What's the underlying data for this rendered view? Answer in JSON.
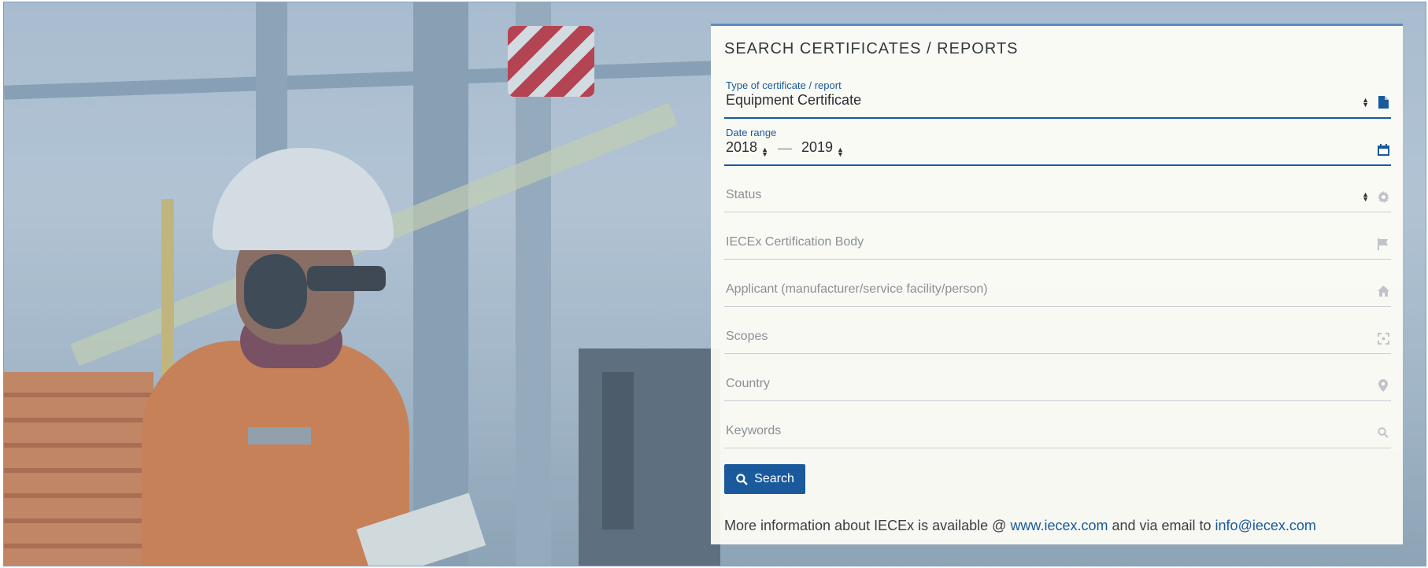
{
  "panel": {
    "title": "SEARCH CERTIFICATES / REPORTS"
  },
  "fields": {
    "type": {
      "label": "Type of certificate / report",
      "value": "Equipment Certificate",
      "icon": "file-icon"
    },
    "date_range": {
      "label": "Date range",
      "from": "2018",
      "to": "2019",
      "separator": "—",
      "icon": "calendar-icon"
    },
    "status": {
      "placeholder": "Status",
      "icon": "gear-icon"
    },
    "cert_body": {
      "placeholder": "IECEx Certification Body",
      "icon": "flag-icon"
    },
    "applicant": {
      "placeholder": "Applicant (manufacturer/service facility/person)",
      "icon": "home-icon"
    },
    "scopes": {
      "placeholder": "Scopes",
      "icon": "scope-icon"
    },
    "country": {
      "placeholder": "Country",
      "icon": "map-marker-icon"
    },
    "keywords": {
      "placeholder": "Keywords",
      "icon": "search-icon"
    }
  },
  "search_button": {
    "label": "Search"
  },
  "info": {
    "text_before": "More information about IECEx is available @ ",
    "link1": "www.iecex.com",
    "text_middle": " and via email to ",
    "link2": "info@iecex.com"
  },
  "colors": {
    "accent": "#1a5a9c",
    "panel_bg": "#fffef6"
  }
}
